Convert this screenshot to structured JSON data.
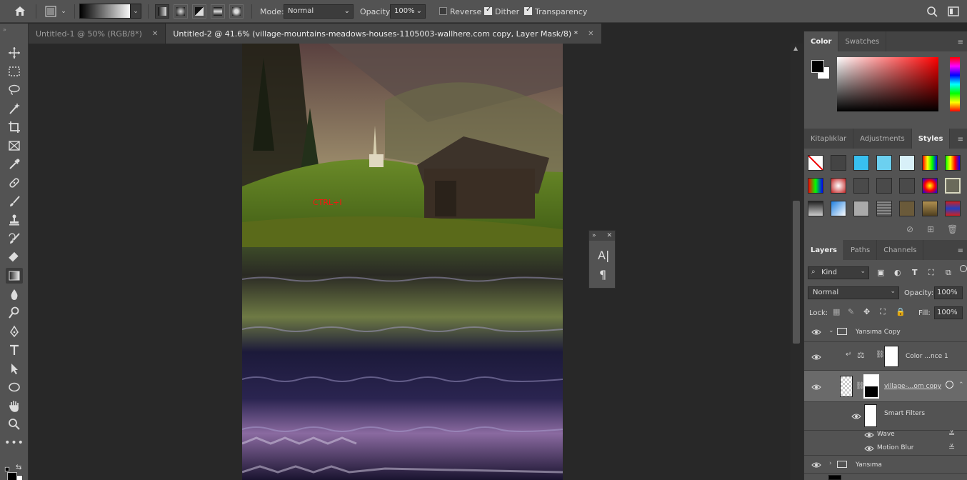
{
  "options_bar": {
    "mode_label": "Mode:",
    "mode_value": "Normal",
    "opacity_label": "Opacity:",
    "opacity_value": "100%",
    "reverse_label": "Reverse",
    "reverse_checked": false,
    "dither_label": "Dither",
    "dither_checked": true,
    "transparency_label": "Transparency",
    "transparency_checked": true
  },
  "tabs": [
    {
      "label": "Untitled-1 @ 50% (RGB/8*)",
      "active": false
    },
    {
      "label": "Untitled-2 @ 41.6% (village-mountains-meadows-houses-1105003-wallhere.com copy, Layer Mask/8) *",
      "active": true
    }
  ],
  "tab_close_glyph": "✕",
  "canvas": {
    "annotation_text": "CTRL+I"
  },
  "color_panel": {
    "tabs": [
      "Color",
      "Swatches"
    ]
  },
  "styles_panel": {
    "tabs": [
      "Kitaplıklar",
      "Adjustments",
      "Styles"
    ]
  },
  "layers_panel": {
    "tabs": [
      "Layers",
      "Paths",
      "Channels"
    ],
    "filter_kind": "Kind",
    "blend_mode": "Normal",
    "opacity_label": "Opacity:",
    "opacity_value": "100%",
    "lock_label": "Lock:",
    "fill_label": "Fill:",
    "fill_value": "100%",
    "layers": [
      {
        "name": "Yansıma Copy",
        "type": "group"
      },
      {
        "name": "Color ...nce 1",
        "type": "adjustment"
      },
      {
        "name": "village-...om copy",
        "type": "smart-object"
      },
      {
        "name": "Smart Filters",
        "type": "smart-filters"
      },
      {
        "name": "Wave",
        "type": "filter"
      },
      {
        "name": "Motion Blur",
        "type": "filter"
      },
      {
        "name": "Yansıma",
        "type": "group"
      }
    ]
  },
  "char_panel": {
    "char_glyph": "A|",
    "para_glyph": "¶"
  },
  "colors": {
    "ui_bg": "#535353",
    "canvas_bg": "#282828",
    "accent": "#ff0000"
  }
}
